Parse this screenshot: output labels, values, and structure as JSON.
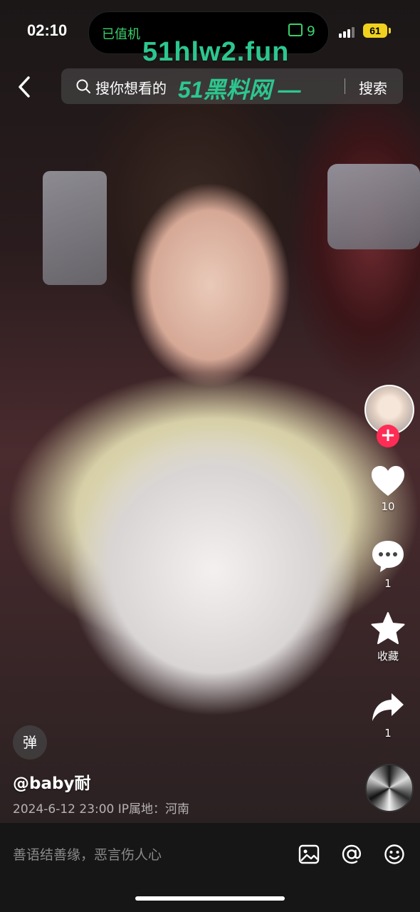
{
  "status_bar": {
    "time": "02:10",
    "island_left": "已值机",
    "island_right": "9",
    "battery": "61"
  },
  "watermark": {
    "top": "51hlw2.fun",
    "inline": "51黑料网 —"
  },
  "search": {
    "placeholder": "搜你想看的",
    "button": "搜索"
  },
  "rail": {
    "like_count": "10",
    "comment_count": "1",
    "favorite_label": "收藏",
    "share_count": "1"
  },
  "video_info": {
    "danmaku_label": "弹",
    "author": "@baby耐",
    "meta": "2024-6-12 23:00  IP属地：河南"
  },
  "comment_bar": {
    "placeholder": "善语结善缘，恶言伤人心"
  },
  "colors": {
    "accent_follow": "#ff2c55",
    "watermark": "#2cc78f",
    "island_text": "#3ad06a",
    "battery": "#f0d21e"
  },
  "icons": [
    "back-icon",
    "search-icon",
    "heart-icon",
    "comment-icon",
    "star-icon",
    "share-icon",
    "image-icon",
    "at-icon",
    "emoji-icon"
  ]
}
